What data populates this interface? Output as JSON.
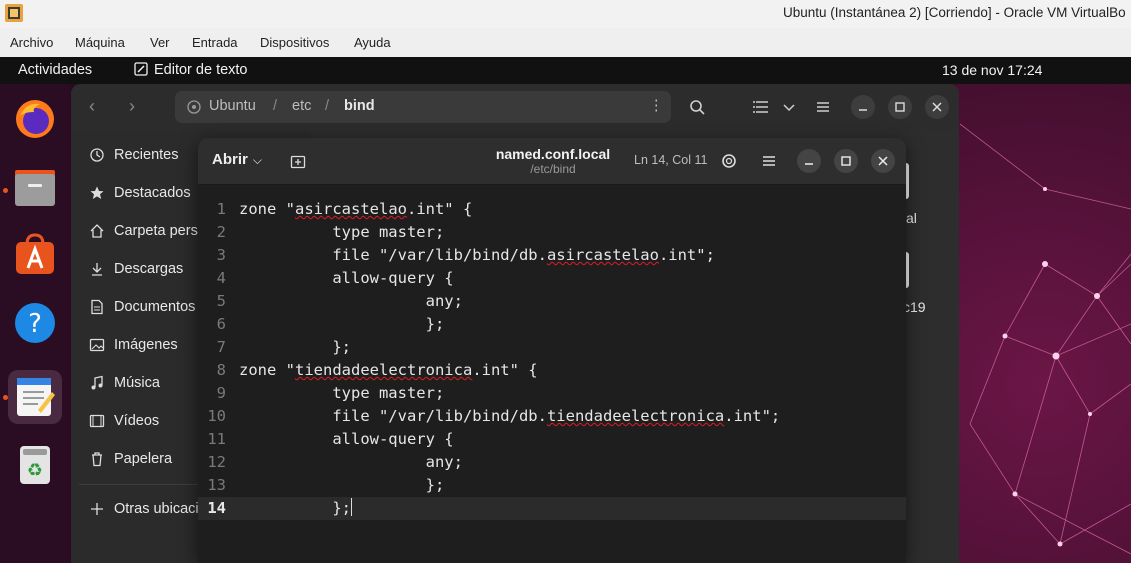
{
  "vbox": {
    "title": "Ubuntu (Instantánea 2) [Corriendo] - Oracle VM VirtualBo",
    "menu": [
      "Archivo",
      "Máquina",
      "Ver",
      "Entrada",
      "Dispositivos",
      "Ayuda"
    ]
  },
  "topbar": {
    "activities": "Actividades",
    "app_name": "Editor de texto",
    "clock": "13 de nov  17:24"
  },
  "dock": {
    "items": [
      {
        "name": "firefox-icon",
        "active": false
      },
      {
        "name": "files-icon",
        "active": false
      },
      {
        "name": "software-store-icon",
        "active": false
      },
      {
        "name": "help-icon",
        "active": false
      },
      {
        "name": "text-editor-icon",
        "active": true
      },
      {
        "name": "trash-icon",
        "active": false
      }
    ]
  },
  "files": {
    "path": [
      "Ubuntu",
      "/",
      "etc",
      "/",
      "bind"
    ],
    "sidebar": [
      {
        "label": "Recientes",
        "icon": "clock-icon"
      },
      {
        "label": "Destacados",
        "icon": "star-icon"
      },
      {
        "label": "Carpeta personal",
        "icon": "home-icon"
      },
      {
        "label": "Descargas",
        "icon": "download-icon"
      },
      {
        "label": "Documentos",
        "icon": "document-icon"
      },
      {
        "label": "Imágenes",
        "icon": "image-icon"
      },
      {
        "label": "Música",
        "icon": "music-icon"
      },
      {
        "label": "Vídeos",
        "icon": "video-icon"
      },
      {
        "label": "Papelera",
        "icon": "trash-icon"
      },
      {
        "label": "Otras ubicaciones",
        "icon": "plus-icon"
      }
    ],
    "partial_labels": [
      "al",
      "c19"
    ]
  },
  "editor": {
    "open_label": "Abrir",
    "filename": "named.conf.local",
    "path": "/etc/bind",
    "position": "Ln 14, Col 11",
    "current_line": 14,
    "lines": [
      "zone \"asircastelao.int\" {",
      "          type master;",
      "          file \"/var/lib/bind/db.asircastelao.int\";",
      "          allow-query {",
      "                    any;",
      "                    };",
      "          };",
      "zone \"tiendadeelectronica.int\" {",
      "          type master;",
      "          file \"/var/lib/bind/db.tiendadeelectronica.int\";",
      "          allow-query {",
      "                    any;",
      "                    };",
      "          };"
    ]
  }
}
